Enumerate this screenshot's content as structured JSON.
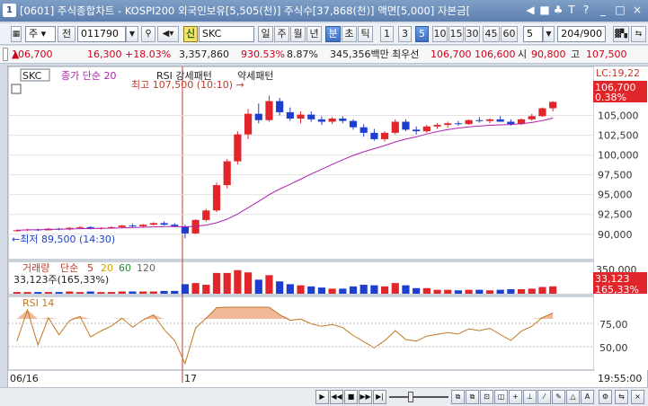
{
  "window": {
    "icon": "1",
    "title": "[0601] 주식종합차트 - KOSPI200 외국인보유[5,505(천)] 주식수[37,868(천)] 액면[5,000] 자본금[",
    "controls": [
      "◀",
      "■",
      "♣",
      "T",
      "?",
      "_",
      "□",
      "×"
    ]
  },
  "toolbar": {
    "market_select": "주",
    "code_label": "전",
    "code_value": "011790",
    "search_icon": "search-icon",
    "sound_icon": "speaker-icon",
    "credit_badge": "신",
    "stock_name": "SKC",
    "period_buttons": [
      "일",
      "주",
      "월",
      "년",
      "분",
      "초",
      "틱"
    ],
    "period_selected": "분",
    "interval_buttons": [
      "1",
      "3",
      "5",
      "10",
      "15",
      "30",
      "45",
      "60"
    ],
    "interval_selected": "5",
    "interval_input": "5",
    "count_input": "204/900"
  },
  "quote": {
    "price": "106,700",
    "change": "16,300",
    "change_pct": "+18.03%",
    "volume": "3,357,860",
    "volume_ratio": "930.53%",
    "turnover": "8.87%",
    "amount": "345,356백만",
    "priority_label": "최우선",
    "ask": "106,700",
    "bid": "106,600",
    "open_label": "시",
    "open": "90,800",
    "high_label": "고",
    "high": "107,500"
  },
  "price_panel": {
    "name": "SKC",
    "indicator": "종가 단순 20",
    "pattern1": "RSI 강세패턴",
    "pattern2": "약세패턴",
    "high_annotation": "최고 107,500 (10:10) →",
    "low_annotation": "←최저 89,500 (14:30)",
    "lc_label": "LC:19,22",
    "last_price_tag": "106,700",
    "last_pct_tag": "0.38%"
  },
  "volume_panel": {
    "label": "거래량",
    "ma_label": "단순",
    "ma_periods": [
      "5",
      "20",
      "60",
      "120"
    ],
    "value": "33,123주(165,33%)",
    "axis_label": "350,000",
    "tag_value": "33,123",
    "tag_pct": "165,33%"
  },
  "rsi_panel": {
    "label": "RSI 14"
  },
  "time_axis": {
    "day1": "06/16",
    "day2": "17",
    "clock": "19:55:00"
  },
  "colors": {
    "up": "#e0262b",
    "down": "#1d3ecf",
    "ma": "#b020b0",
    "rsi": "#c07820",
    "rsi_fill": "#f2b89a"
  },
  "chart_data": {
    "type": "candlestick",
    "price_axis_ticks": [
      "105,000",
      "102,500",
      "100,000",
      "97,500",
      "95,000",
      "92,500",
      "90,000"
    ],
    "ylim": [
      88500,
      108000
    ],
    "candles": [
      [
        90400,
        90600,
        90300,
        90500
      ],
      [
        90500,
        90700,
        90400,
        90600
      ],
      [
        90600,
        90700,
        90400,
        90500
      ],
      [
        90500,
        90800,
        90500,
        90700
      ],
      [
        90700,
        90800,
        90500,
        90600
      ],
      [
        90600,
        90900,
        90500,
        90800
      ],
      [
        90800,
        91000,
        90700,
        90900
      ],
      [
        90900,
        91000,
        90600,
        90700
      ],
      [
        90700,
        90900,
        90600,
        90800
      ],
      [
        90800,
        91000,
        90700,
        90900
      ],
      [
        90900,
        91200,
        90800,
        91100
      ],
      [
        91100,
        91300,
        90900,
        91000
      ],
      [
        91000,
        91300,
        90900,
        91200
      ],
      [
        91200,
        91500,
        91100,
        91400
      ],
      [
        91400,
        91600,
        91100,
        91200
      ],
      [
        91200,
        91400,
        90900,
        91000
      ],
      [
        91000,
        91200,
        89500,
        90100
      ],
      [
        90100,
        91900,
        90000,
        91800
      ],
      [
        91800,
        93200,
        91600,
        93000
      ],
      [
        93000,
        96500,
        92800,
        96200
      ],
      [
        96200,
        99500,
        95800,
        99200
      ],
      [
        99200,
        103000,
        98800,
        102600
      ],
      [
        102600,
        105800,
        102000,
        105200
      ],
      [
        105200,
        106500,
        104000,
        104400
      ],
      [
        104400,
        107500,
        104200,
        106800
      ],
      [
        106800,
        107200,
        105000,
        105400
      ],
      [
        105400,
        106000,
        104300,
        104600
      ],
      [
        104600,
        105500,
        104000,
        105100
      ],
      [
        105100,
        105500,
        104200,
        104500
      ],
      [
        104500,
        104900,
        103800,
        104200
      ],
      [
        104200,
        104800,
        103900,
        104600
      ],
      [
        104600,
        104900,
        104000,
        104300
      ],
      [
        104300,
        104500,
        103200,
        103500
      ],
      [
        103500,
        103900,
        102300,
        102800
      ],
      [
        102800,
        103300,
        101800,
        102000
      ],
      [
        102000,
        103000,
        101700,
        102800
      ],
      [
        102800,
        104500,
        102600,
        104200
      ],
      [
        104200,
        104500,
        103000,
        103200
      ],
      [
        103200,
        103600,
        102600,
        103000
      ],
      [
        103000,
        103800,
        102800,
        103600
      ],
      [
        103600,
        104000,
        103300,
        103800
      ],
      [
        103800,
        104200,
        103500,
        104000
      ],
      [
        104000,
        104300,
        103700,
        103900
      ],
      [
        103900,
        104500,
        103800,
        104400
      ],
      [
        104400,
        104800,
        104100,
        104300
      ],
      [
        104300,
        104600,
        104000,
        104500
      ],
      [
        104500,
        104900,
        104200,
        104200
      ],
      [
        104200,
        104500,
        103700,
        103900
      ],
      [
        103900,
        104600,
        103800,
        104500
      ],
      [
        104500,
        105200,
        104300,
        104900
      ],
      [
        104900,
        106000,
        104800,
        105900
      ],
      [
        105900,
        106800,
        105500,
        106700
      ]
    ],
    "ma20": [
      90500,
      90550,
      90580,
      90600,
      90620,
      90660,
      90700,
      90720,
      90740,
      90770,
      90800,
      90840,
      90880,
      90930,
      90960,
      90970,
      90930,
      91000,
      91150,
      91450,
      91900,
      92550,
      93350,
      94150,
      95000,
      95700,
      96300,
      96950,
      97600,
      98200,
      98800,
      99400,
      99950,
      100400,
      100800,
      101200,
      101650,
      102000,
      102300,
      102650,
      102950,
      103200,
      103400,
      103550,
      103650,
      103750,
      103800,
      103850,
      103950,
      104100,
      104350,
      104650
    ],
    "volume_axis": [
      "350,000"
    ],
    "rsi_axis": [
      "75,00",
      "50,00"
    ]
  }
}
